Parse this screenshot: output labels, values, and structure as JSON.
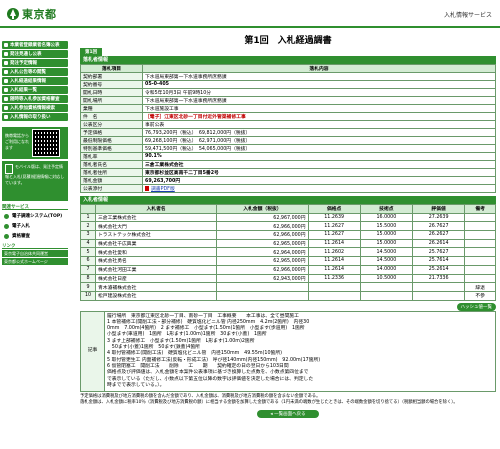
{
  "header": {
    "logo_text": "東京都",
    "site_name": "入札情報サービス"
  },
  "sidebar": {
    "buttons": [
      "本業者登録業者名簿公表",
      "発注見通し公表",
      "発注予定情報",
      "入札公告等の閲覧",
      "入札経過結果情報",
      "入札結果一覧",
      "随時等入札参加資格審査",
      "入札参加資格情報検索",
      "入札情報の取り扱い"
    ],
    "qr_label": "携帯電話からご利用になれます",
    "mobile_text": "モバイル版は、発注予定情報と入札(見積)経過情報に対応しています。",
    "section_links": "リンク",
    "links_title": "関連サービス",
    "plain_items": [
      "電子調達システム(TOP)",
      "電子入札",
      "資格審査"
    ],
    "extra_links": [
      "東京電子自治体共同運営",
      "東京都公式ホームページ"
    ]
  },
  "page": {
    "title": "第1回　入札経過調書",
    "round_badge": "第1回",
    "info_band": "落札者情報",
    "bid_band": "入札者情報",
    "pdf_label": "調書PDF版",
    "bid_detail_button": "ハッシュ値一覧",
    "back_button": "一覧画面へ戻る"
  },
  "info_table": {
    "col1": "落札項目",
    "col2": "落札内容",
    "rows": [
      {
        "k": "契約部署",
        "v": "下水道局東部第一下水道事務所庶務課"
      },
      {
        "k": "契約番号",
        "v": "05-0-405"
      },
      {
        "k": "開札日時",
        "v": "令和5年10月3日 午前9時10分"
      },
      {
        "k": "開札場所",
        "v": "下水道局東部第一下水道事務所庶務課"
      },
      {
        "k": "業種",
        "v": "下水道施設工事"
      },
      {
        "k": "件　名",
        "v": "［電子］江東区北砂一丁目付近外管渠補修工事"
      },
      {
        "k": "公表区分",
        "v": "事前公表"
      },
      {
        "k": "予定価格",
        "v": "76,793,200円（税込）　69,812,000円（税抜）"
      },
      {
        "k": "最低制限価格",
        "v": "69,268,100円（税込）　62,971,000円（税抜）"
      },
      {
        "k": "特別基準価格",
        "v": "59,471,500円（税込）　54,065,000円（税抜）"
      },
      {
        "k": "落札率",
        "v": "90.1%"
      },
      {
        "k": "落札者氏名",
        "v": "三倉工業株式会社"
      },
      {
        "k": "落札者住所",
        "v": "東京都杉並区高南千二丁目5番2号"
      },
      {
        "k": "落札金額",
        "v": "69,263,700円"
      },
      {
        "k": "公表添付",
        "v": ""
      }
    ]
  },
  "bid_table": {
    "headers": [
      "",
      "入札者名",
      "入札金額（税抜）",
      "価格点",
      "技術点",
      "評価値",
      "備考"
    ],
    "rows": [
      {
        "no": "1",
        "name": "三倉工業株式会社",
        "amount": "62,967,000円",
        "p": "11.2639",
        "t": "16.0000",
        "e": "27.2639",
        "note": ""
      },
      {
        "no": "2",
        "name": "株式会社大門",
        "amount": "62,966,000円",
        "p": "11.2627",
        "t": "15.5000",
        "e": "26.7627",
        "note": ""
      },
      {
        "no": "3",
        "name": "トラストテック株式会社",
        "amount": "62,966,000円",
        "p": "11.2627",
        "t": "15.0000",
        "e": "26.2627",
        "note": ""
      },
      {
        "no": "4",
        "name": "株式会社千広興業",
        "amount": "62,965,000円",
        "p": "11.2614",
        "t": "15.0000",
        "e": "26.2614",
        "note": ""
      },
      {
        "no": "5",
        "name": "株式会社愛和",
        "amount": "62,964,000円",
        "p": "11.2602",
        "t": "14.5000",
        "e": "25.7627",
        "note": ""
      },
      {
        "no": "6",
        "name": "株式会社勇名",
        "amount": "62,965,000円",
        "p": "11.2614",
        "t": "14.5000",
        "e": "25.7614",
        "note": ""
      },
      {
        "no": "7",
        "name": "株式会社河田工業",
        "amount": "62,966,000円",
        "p": "11.2614",
        "t": "14.0000",
        "e": "25.2614",
        "note": ""
      },
      {
        "no": "8",
        "name": "株式会社日産",
        "amount": "62,943,000円",
        "p": "11.2336",
        "t": "10.5000",
        "e": "21.7336",
        "note": ""
      },
      {
        "no": "9",
        "name": "青木濬補株式会社",
        "amount": "",
        "p": "",
        "t": "",
        "e": "",
        "note": "辞退"
      },
      {
        "no": "10",
        "name": "松戸建設株式会社",
        "amount": "",
        "p": "",
        "t": "",
        "e": "",
        "note": "不参"
      }
    ]
  },
  "notes": {
    "label": "記事",
    "lines": [
      "履行場所　東京都江東区北砂一丁目、南砂一丁目　工事概要　　本工事は、全て昼間施工",
      "1 本管補修工(開削工法・部分補修)　硬質塩化ビニル管 内径250mm　4.2m(2箇所)　内径30",
      "0mm　7.00m(4箇所)　2 ます補修工　小型ます(1.50m)1箇所　小型ます(歩道用)　1箇所",
      "小型ます(車道用)　1箇所　L形ます(1.00m)1箇所　30ます(小蓋)　1箇所",
      "3 ます上部補修工　小型ます(1.50m)1箇所　L形ます(1.00m)2箇所",
      "　50ます(小蓋)1箇所　50ます(鉄蓋)4箇所",
      "4 取付管補修工(開削工法)　硬質塩化ビニル管　内径150mm　49.55m(10箇所)",
      "5 取付管更生工 内面補修工法(反転・形成工法)　呼び径140mm(内径150mm)　92.00m(17箇所)",
      "6 仮管閉塞工　開削工法　　削除　　工　　期　　契約確定の日の翌日から103日間",
      "価格点及び評価値は、入札金額を本案件公表事項に基づき換算した点数を、小数点第四位まで",
      "で表示している（ただし、小数点以下第五位以降の数字は評価値を決定した場合には、判定した",
      "時までで表示している。）。"
    ]
  },
  "footer": {
    "lines": [
      "予定価格は消費税及び地方消費税の額を含んだ金額であり、入札金額は、消費税及び地方消費税の額を含まない金額である。",
      "落札金額は、入札金額に税率10％（消費税及び地方消費税の額）に相当する金額を加算した金額である（1円未満の端数が生じたときは、その端数金額を切り捨てる）（税額相当額の場合を除く）。"
    ]
  },
  "colors": {
    "brand": "#2f8f2f",
    "alert": "#c00000"
  }
}
